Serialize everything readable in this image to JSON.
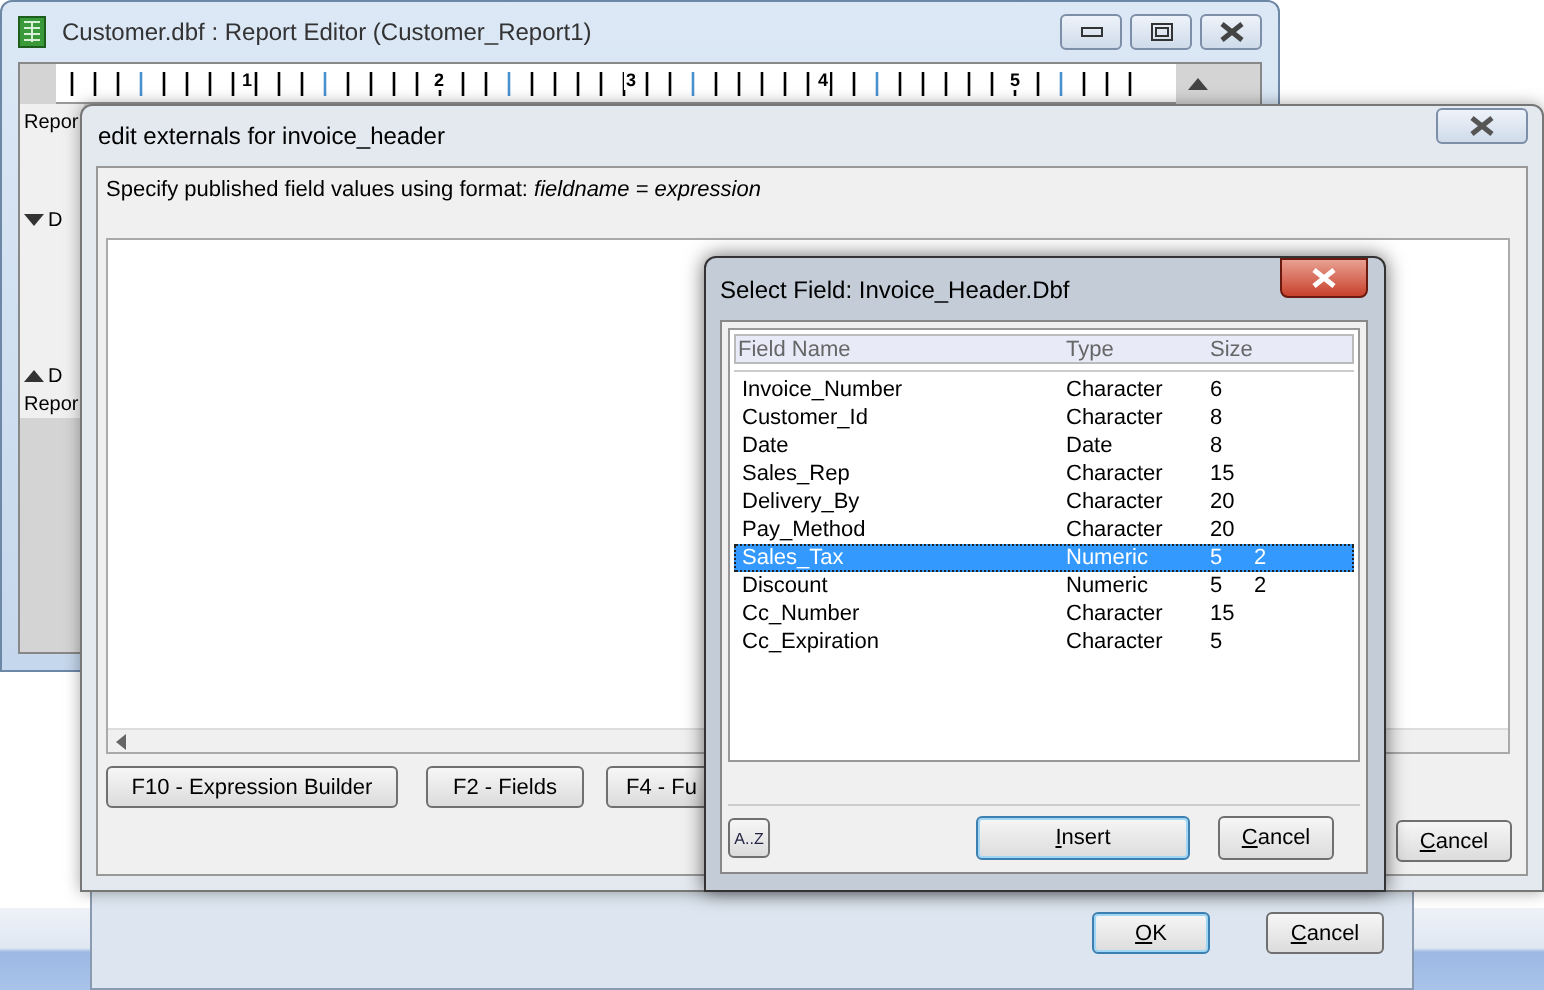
{
  "report_editor": {
    "title": "Customer.dbf : Report Editor (Customer_Report1)",
    "ruler_labels": [
      "1",
      "2",
      "3",
      "4",
      "5"
    ],
    "side_labels": [
      {
        "kind": "text",
        "text": "Repor"
      },
      {
        "kind": "down",
        "text": "D"
      },
      {
        "kind": "up",
        "text": "D"
      },
      {
        "kind": "text",
        "text": "Repor"
      }
    ]
  },
  "externals_dialog": {
    "title": "edit externals for invoice_header",
    "instruction": "Specify published field values using format:  *fieldname = expression*",
    "buttons": [
      "F10 - Expression Builder",
      "F2 - Fields",
      "F4 - Fu"
    ],
    "cancel": "Cancel"
  },
  "select_field": {
    "title": "Select Field: Invoice_Header.Dbf",
    "columns": [
      "Field Name",
      "Type",
      "Size"
    ],
    "rows": [
      {
        "name": "Invoice_Number",
        "type": "Character",
        "size": "6",
        "selected": false
      },
      {
        "name": "Customer_Id",
        "type": "Character",
        "size": "8",
        "selected": false
      },
      {
        "name": "Date",
        "type": "Date",
        "size": "8",
        "selected": false
      },
      {
        "name": "Sales_Rep",
        "type": "Character",
        "size": "15",
        "selected": false
      },
      {
        "name": "Delivery_By",
        "type": "Character",
        "size": "20",
        "selected": false
      },
      {
        "name": "Pay_Method",
        "type": "Character",
        "size": "20",
        "selected": false
      },
      {
        "name": "Sales_Tax",
        "type": "Numeric",
        "size": "5",
        "decimals": "2",
        "selected": true
      },
      {
        "name": "Discount",
        "type": "Numeric",
        "size": "5",
        "decimals": "2",
        "selected": false
      },
      {
        "name": "Cc_Number",
        "type": "Character",
        "size": "15",
        "selected": false
      },
      {
        "name": "Cc_Expiration",
        "type": "Character",
        "size": "5",
        "selected": false
      }
    ],
    "sort_button": "A..Z",
    "insert": "Insert",
    "cancel": "Cancel"
  },
  "back_dialog": {
    "ok": "OK",
    "cancel": "Cancel"
  }
}
